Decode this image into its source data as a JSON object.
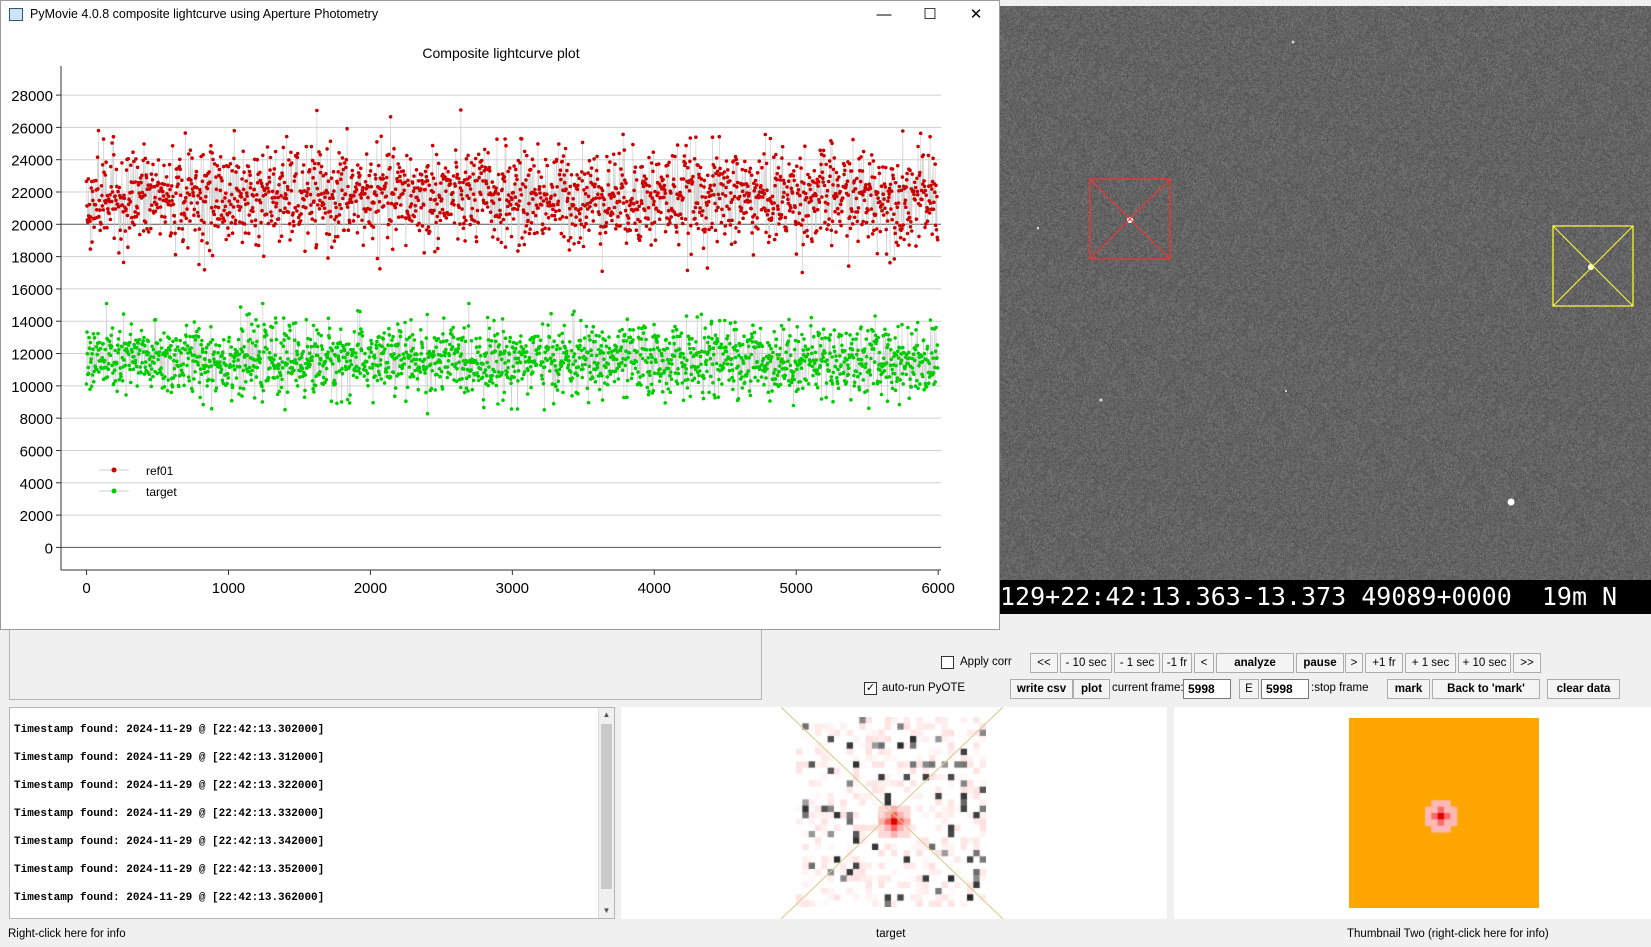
{
  "window": {
    "title": "PyMovie 4.0.8 composite lightcurve using Aperture Photometry",
    "minimize_glyph": "—",
    "maximize_glyph": "☐",
    "close_glyph": "✕"
  },
  "chart_data": {
    "type": "scatter",
    "title": "Composite lightcurve plot",
    "xlabel": "",
    "ylabel": "",
    "xlim": [
      -180,
      6020
    ],
    "ylim": [
      -1400,
      29800
    ],
    "x_ticks": [
      "0",
      "1000",
      "2000",
      "3000",
      "4000",
      "5000",
      "6000"
    ],
    "y_ticks": [
      "0",
      "2000",
      "4000",
      "6000",
      "8000",
      "10000",
      "12000",
      "14000",
      "16000",
      "18000",
      "20000",
      "22000",
      "24000",
      "26000",
      "28000"
    ],
    "n_points": 5999,
    "series": [
      {
        "name": "ref01",
        "color": "#cc0000",
        "mean": 21700,
        "spread": 1500,
        "range": [
          14800,
          28400
        ]
      },
      {
        "name": "target",
        "color": "#00cc00",
        "mean": 11600,
        "spread": 1100,
        "range": [
          6500,
          15100
        ]
      }
    ],
    "grid": true,
    "legend": "upper-left"
  },
  "video_overlay": {
    "timestamp_text": "129+22:42:13.363-13.373 49089+0000  19m N"
  },
  "controls": {
    "apply_corr_label": "Apply corr",
    "apply_corr_checked": false,
    "auto_run_label": "auto-run PyOTE",
    "auto_run_checked": true,
    "check_glyph": "✓",
    "nav_buttons": [
      "<<",
      "- 10 sec",
      "- 1 sec",
      "-1 fr",
      "<",
      "analyze",
      "pause",
      ">",
      "+1 fr",
      "+ 1 sec",
      "+ 10 sec",
      ">>"
    ],
    "write_csv_label": "write csv",
    "plot_label": "plot",
    "current_frame_label": "current frame:",
    "current_frame_value": "5998",
    "e_button_label": "E",
    "stop_frame_value": "5998",
    "stop_frame_label": ":stop frame",
    "mark_label": "mark",
    "back_to_mark_label": "Back to 'mark'",
    "clear_data_label": "clear data"
  },
  "log": {
    "lines": [
      "Timestamp found: 2024-11-29 @ [22:42:13.302000]",
      "Timestamp found: 2024-11-29 @ [22:42:13.312000]",
      "Timestamp found: 2024-11-29 @ [22:42:13.322000]",
      "Timestamp found: 2024-11-29 @ [22:42:13.332000]",
      "Timestamp found: 2024-11-29 @ [22:42:13.342000]",
      "Timestamp found: 2024-11-29 @ [22:42:13.352000]",
      "Timestamp found: 2024-11-29 @ [22:42:13.362000]"
    ],
    "scroll_up_glyph": "▲",
    "scroll_down_glyph": "▼"
  },
  "status": {
    "left_text": "Right-click here for info",
    "thumb1_caption": "target",
    "thumb2_caption": "Thumbnail Two (right-click here for info)"
  },
  "colors": {
    "ref_aperture": "#ff3030",
    "target_aperture": "#ffff3a",
    "thumb2_background": "#ffa500"
  }
}
